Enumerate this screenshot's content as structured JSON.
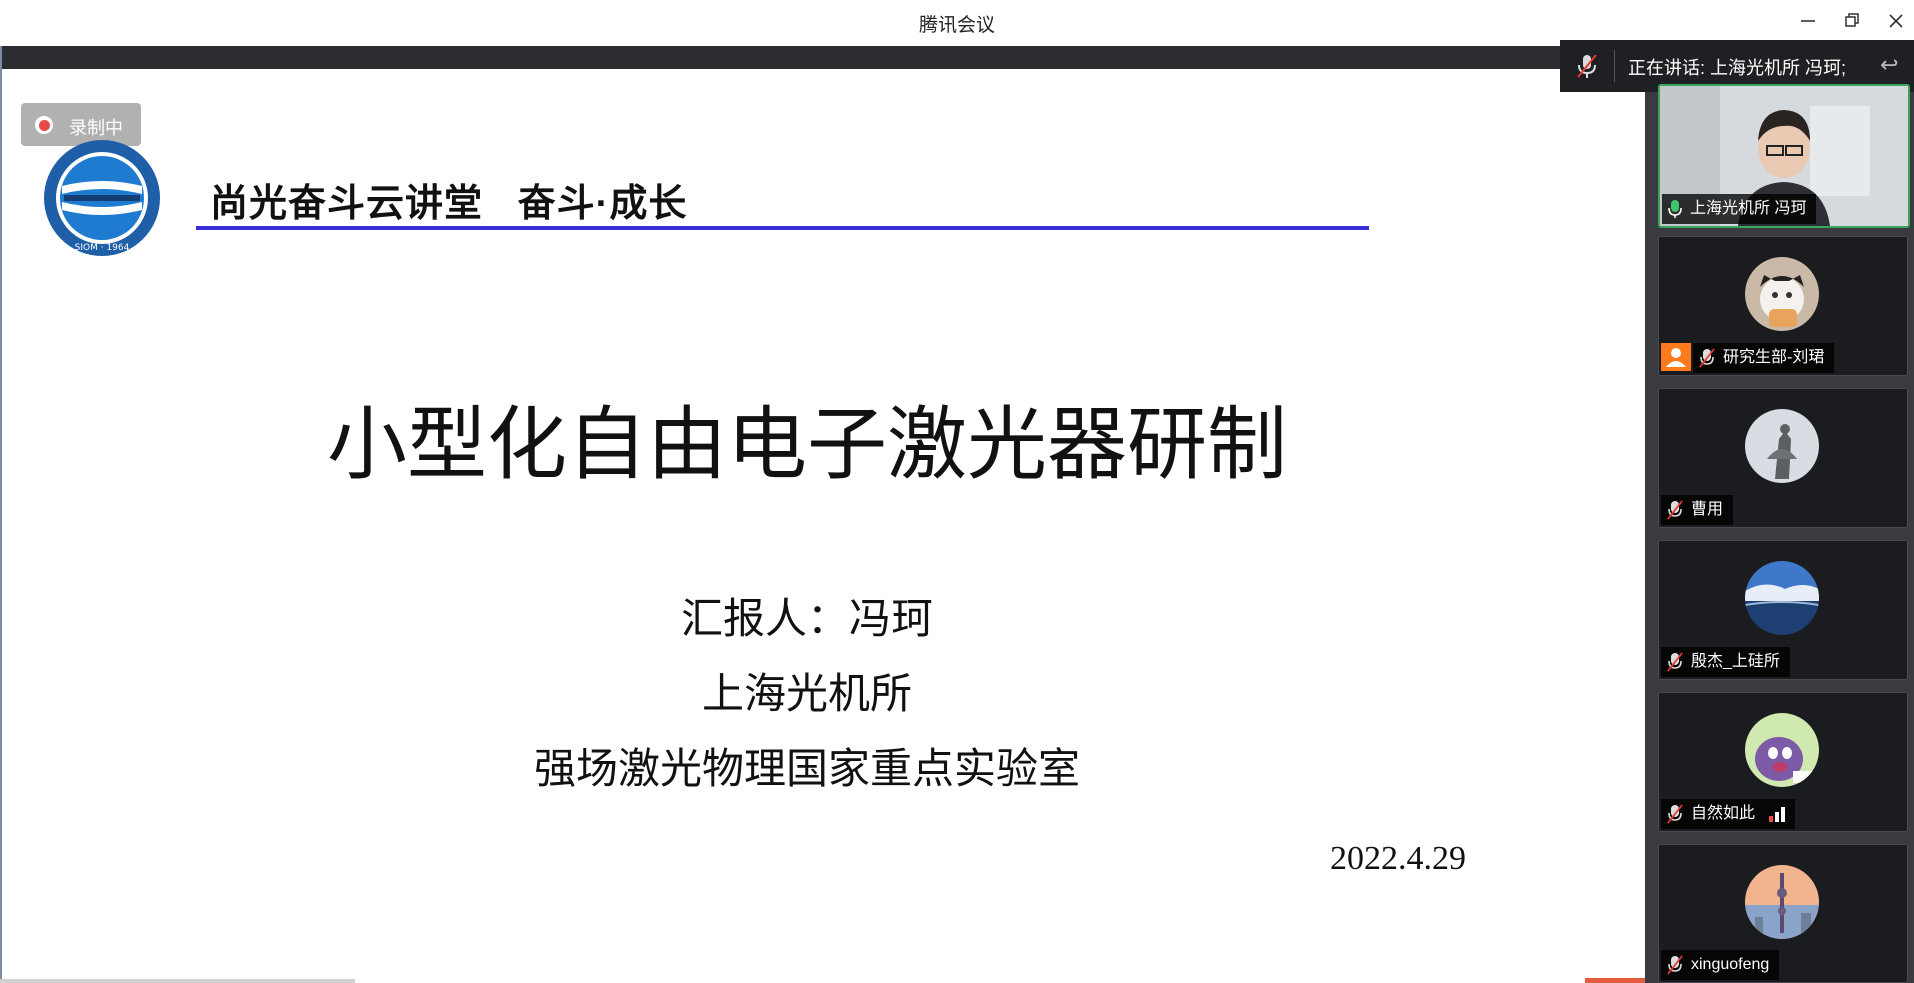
{
  "window": {
    "title": "腾讯会议"
  },
  "recording": {
    "label": "录制中"
  },
  "slide": {
    "header": "尚光奋斗云讲堂   奋斗·成长",
    "logo_text": "SIOM · 1964",
    "title": "小型化自由电子激光器研制",
    "reporter": "汇报人：冯珂",
    "institute": "上海光机所",
    "lab": "强场激光物理国家重点实验室",
    "date": "2022.4.29"
  },
  "speaking": {
    "label": "正在讲话: 上海光机所 冯珂;"
  },
  "participants": [
    {
      "name": "上海光机所 冯珂",
      "mic": "on",
      "active": true
    },
    {
      "name": "研究生部-刘珺",
      "mic": "muted",
      "role_badge": true
    },
    {
      "name": "曹用",
      "mic": "muted"
    },
    {
      "name": "殷杰_上硅所",
      "mic": "muted"
    },
    {
      "name": "自然如此",
      "mic": "muted",
      "signal": "weak"
    },
    {
      "name": "xinguofeng",
      "mic": "muted"
    }
  ],
  "colors": {
    "accent_line": "#3a2fd6",
    "active_border": "#3aa55b",
    "record_dot": "#e53935",
    "panel_bg": "#3a3b3f"
  }
}
